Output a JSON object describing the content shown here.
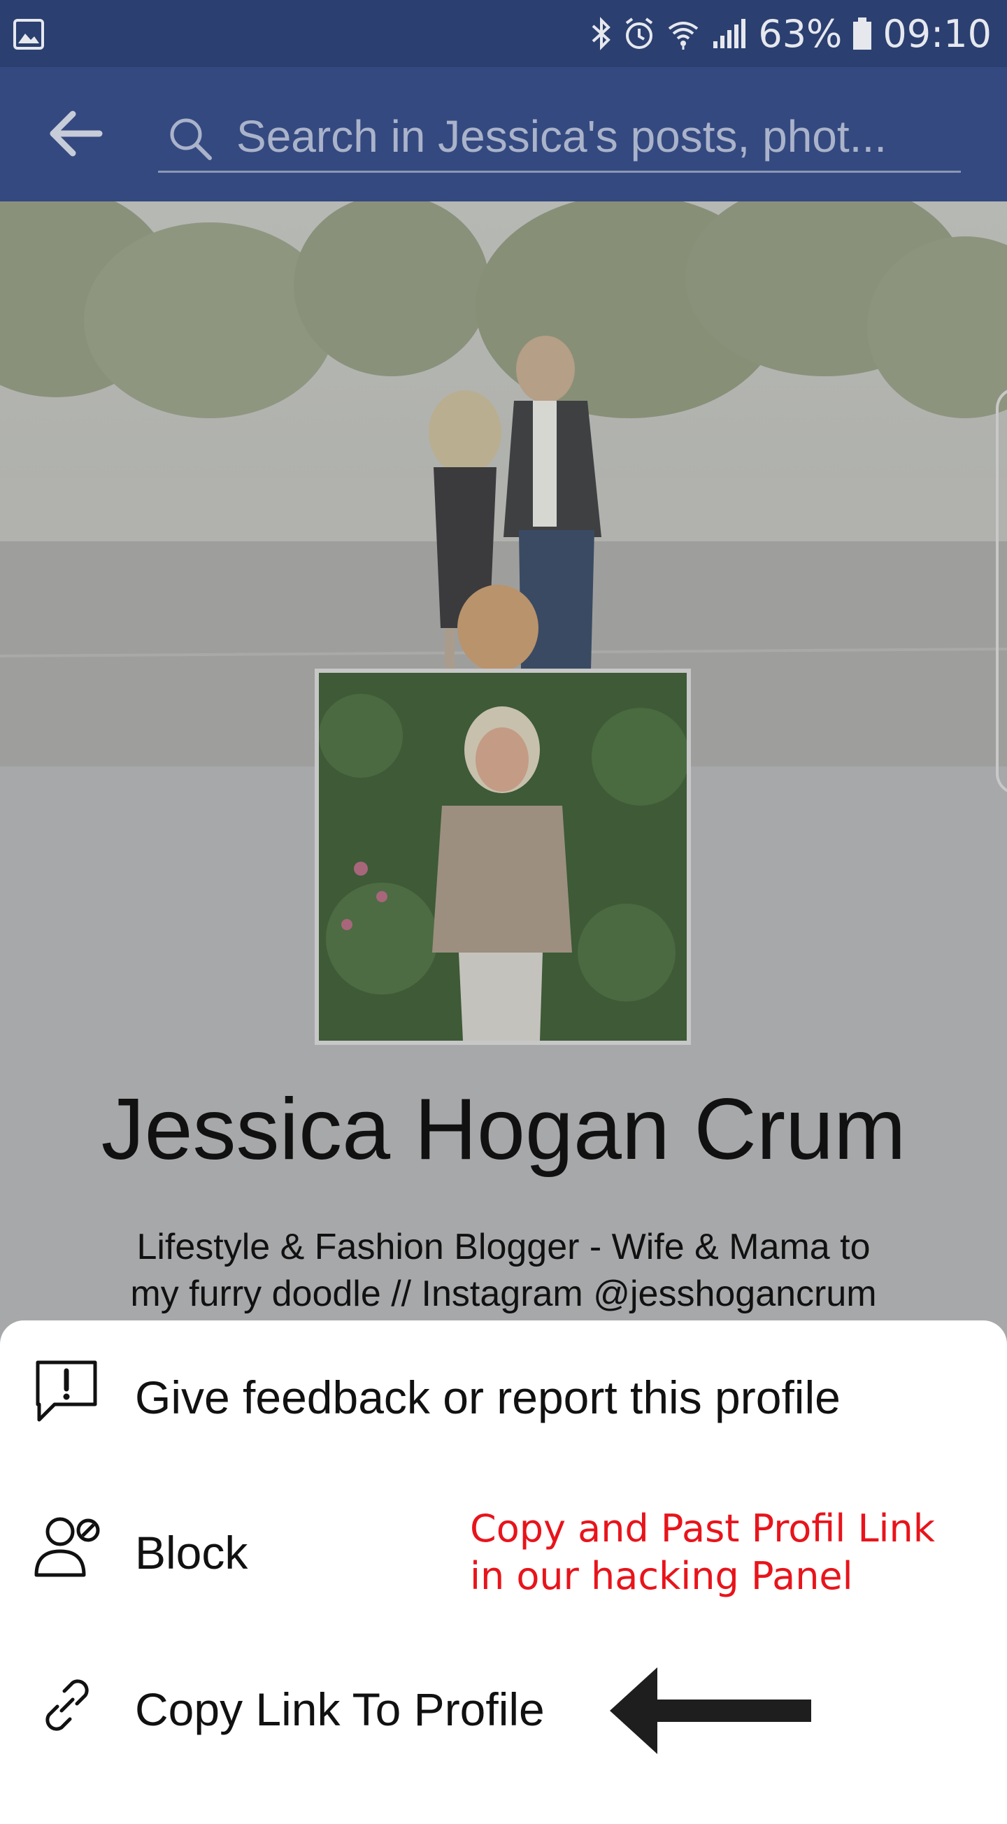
{
  "status_bar": {
    "battery": "63%",
    "time": "09:10",
    "icons": [
      "gallery-icon",
      "bluetooth-icon",
      "alarm-icon",
      "wifi-icon",
      "signal-icon",
      "battery-icon"
    ]
  },
  "search": {
    "placeholder": "Search in Jessica's posts, phot..."
  },
  "profile": {
    "name": "Jessica Hogan Crum",
    "bio_line1": "Lifestyle & Fashion Blogger - Wife & Mama to",
    "bio_line2": "my furry doodle // Instagram @jesshogancrum"
  },
  "menu": {
    "items": [
      {
        "label": "Give feedback or report this profile",
        "icon": "report-icon"
      },
      {
        "label": "Block",
        "icon": "block-user-icon"
      },
      {
        "label": "Copy Link To Profile",
        "icon": "link-icon"
      }
    ]
  },
  "annotation": {
    "line1": "Copy and Past Profil Link",
    "line2": "in our hacking Panel",
    "color": "#e8141b"
  },
  "colors": {
    "status_bar": "#2b3f70",
    "header": "#34497f",
    "overlay_bg": "#a7a8aa"
  }
}
